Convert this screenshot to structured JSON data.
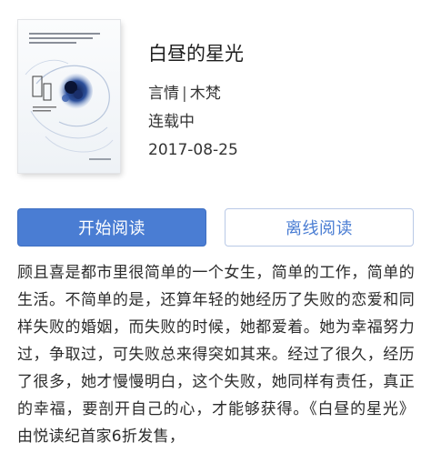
{
  "book": {
    "title": "白昼的星光",
    "category": "言情",
    "separator": "|",
    "author": "木梵",
    "status": "连载中",
    "date": "2017-08-25"
  },
  "actions": {
    "start_reading": "开始阅读",
    "offline_reading": "离线阅读"
  },
  "synopsis": "顾且喜是都市里很简单的一个女生，简单的工作，简单的生活。不简单的是，还算年轻的她经历了失败的恋爱和同样失败的婚姻，而失败的时候，她都爱着。她为幸福努力过，争取过，可失败总来得突如其来。经过了很久，经历了很多，她才慢慢明白，这个失败，她同样有责任，真正的幸福，要剖开自己的心，才能够获得。《白昼的星光》由悦读纪首家6折发售，",
  "colors": {
    "accent": "#4a7dd3",
    "accent_border": "#b9c9e6",
    "text": "#2b2b2b"
  }
}
